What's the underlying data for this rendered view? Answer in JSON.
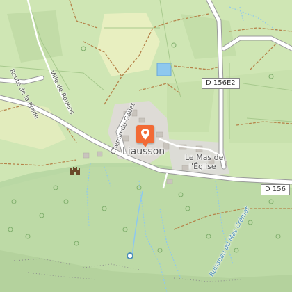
{
  "map": {
    "village_label": "Liausson",
    "hamlet_label_line1": "Le Mas de",
    "hamlet_label_line2": "l'Église",
    "road_badges": [
      "D 156E2",
      "D 156"
    ],
    "street_labels": [
      "Chemin du Gabet",
      "Route de la Prade",
      "Ville de Rouens"
    ],
    "stream_label": "Ruisseau du Mas Crémat",
    "colors": {
      "forest": "#b9d8a4",
      "farmland": "#e8efc0",
      "meadow": "#cfe6b4",
      "road": "#ffffff",
      "path": "#b5834a",
      "stream": "#8ec8ee",
      "marker": "#f26a35"
    },
    "icons": [
      "location-pin-icon",
      "castle-icon",
      "tree-icon"
    ]
  }
}
